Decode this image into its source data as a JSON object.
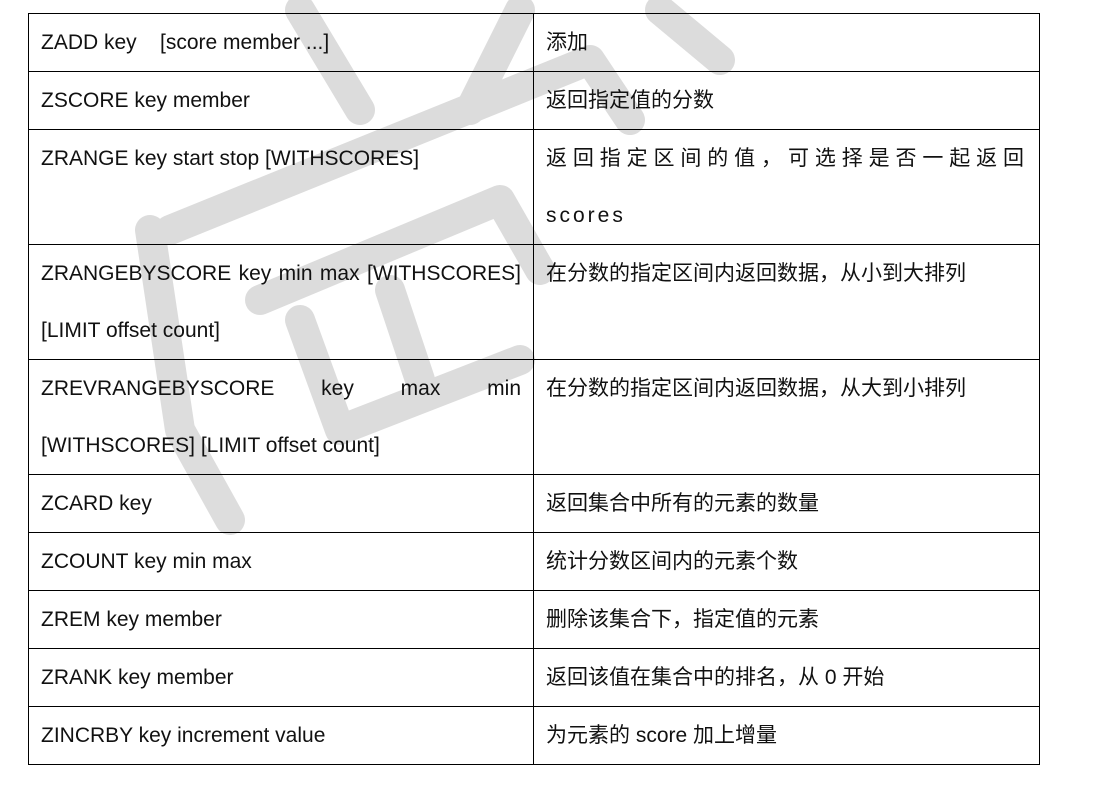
{
  "colors": {
    "border": "#000000",
    "text": "#111111",
    "watermark": "#cfcfcf"
  },
  "rows": [
    {
      "command": "ZADD key    [score member ...]",
      "description": "添加"
    },
    {
      "command": "ZSCORE key member",
      "description": "返回指定值的分数"
    },
    {
      "command": "ZRANGE key start stop [WITHSCORES]",
      "description": "返回指定区间的值，可选择是否一起返回 scores"
    },
    {
      "command": "ZRANGEBYSCORE key min max [WITHSCORES] [LIMIT offset count]",
      "description": "在分数的指定区间内返回数据，从小到大排列"
    },
    {
      "command": "ZREVRANGEBYSCORE key max min [WITHSCORES] [LIMIT offset count]",
      "description": "在分数的指定区间内返回数据，从大到小排列"
    },
    {
      "command": "ZCARD key",
      "description": "返回集合中所有的元素的数量"
    },
    {
      "command": "ZCOUNT key min max",
      "description": "统计分数区间内的元素个数"
    },
    {
      "command": "ZREM key member",
      "description": "删除该集合下，指定值的元素"
    },
    {
      "command": "ZRANK key member",
      "description": "返回该值在集合中的排名，从 0 开始"
    },
    {
      "command": "ZINCRBY key increment value",
      "description": "为元素的 score 加上增量"
    }
  ]
}
